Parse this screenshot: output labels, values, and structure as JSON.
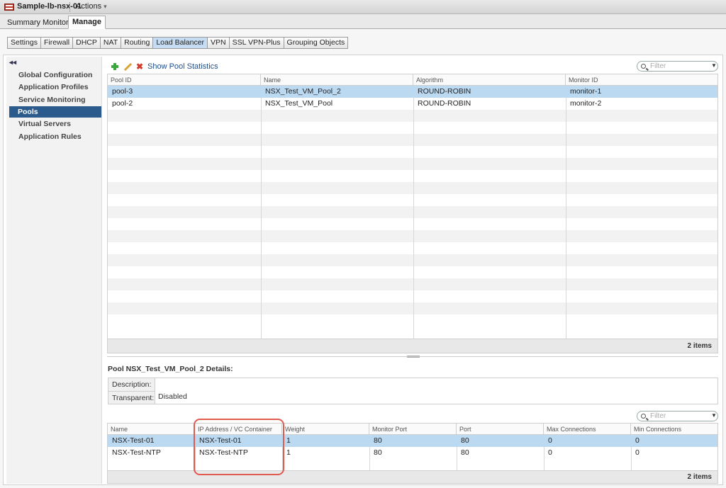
{
  "header": {
    "object_title": "Sample-lb-nsx-01",
    "actions_label": "Actions",
    "actions_caret": "▾"
  },
  "main_tabs": [
    {
      "label": "Summary"
    },
    {
      "label": "Monitor"
    },
    {
      "label": "Manage"
    }
  ],
  "sub_tabs": [
    {
      "label": "Settings"
    },
    {
      "label": "Firewall"
    },
    {
      "label": "DHCP"
    },
    {
      "label": "NAT"
    },
    {
      "label": "Routing"
    },
    {
      "label": "Load Balancer"
    },
    {
      "label": "VPN"
    },
    {
      "label": "SSL VPN-Plus"
    },
    {
      "label": "Grouping Objects"
    }
  ],
  "sidebar": {
    "collapse_glyph": "◂◂",
    "items": [
      {
        "label": "Global Configuration"
      },
      {
        "label": "Application Profiles"
      },
      {
        "label": "Service Monitoring"
      },
      {
        "label": "Pools"
      },
      {
        "label": "Virtual Servers"
      },
      {
        "label": "Application Rules"
      }
    ]
  },
  "toolbar": {
    "show_stats_label": "Show Pool Statistics",
    "delete_glyph": "✖"
  },
  "pool_filter": {
    "placeholder": "Filter"
  },
  "pools_table": {
    "columns": [
      "Pool ID",
      "Name",
      "Algorithm",
      "Monitor ID"
    ],
    "rows": [
      [
        "pool-3",
        "NSX_Test_VM_Pool_2",
        "ROUND-ROBIN",
        "monitor-1"
      ],
      [
        "pool-2",
        "NSX_Test_VM_Pool",
        "ROUND-ROBIN",
        "monitor-2"
      ]
    ],
    "footer": "2 items"
  },
  "details": {
    "title": "Pool NSX_Test_VM_Pool_2 Details:",
    "description_label": "Description:",
    "description_value": "",
    "transparent_label": "Transparent:",
    "transparent_value": "Disabled"
  },
  "member_filter": {
    "placeholder": "Filter"
  },
  "members_table": {
    "columns": [
      "Name",
      "IP Address / VC Container",
      "Weight",
      "Monitor Port",
      "Port",
      "Max Connections",
      "Min Connections"
    ],
    "rows": [
      [
        "NSX-Test-01",
        "NSX-Test-01",
        "1",
        "80",
        "80",
        "0",
        "0"
      ],
      [
        "NSX-Test-NTP",
        "NSX-Test-NTP",
        "1",
        "80",
        "80",
        "0",
        "0"
      ]
    ],
    "footer": "2 items"
  },
  "colors": {
    "selected_row": "#bcd9f2",
    "nav_active": "#2b5b8c",
    "highlight_box": "#e05a50"
  }
}
